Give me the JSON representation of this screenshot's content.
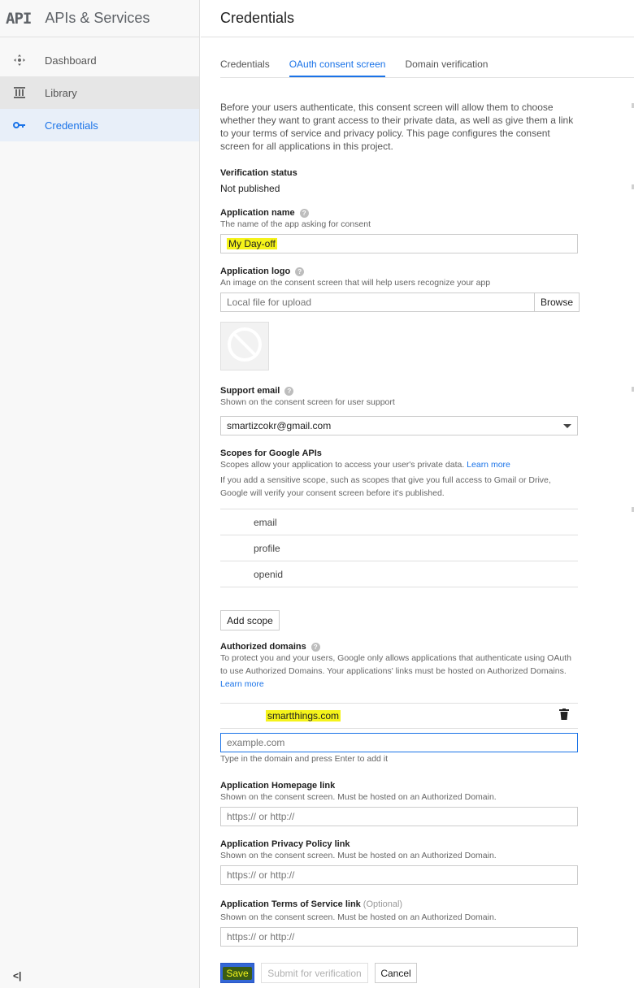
{
  "sidebar": {
    "logo": "API",
    "title": "APIs & Services",
    "items": [
      {
        "label": "Dashboard"
      },
      {
        "label": "Library"
      },
      {
        "label": "Credentials"
      }
    ],
    "collapse_icon": "<|"
  },
  "header": {
    "title": "Credentials"
  },
  "tabs": [
    "Credentials",
    "OAuth consent screen",
    "Domain verification"
  ],
  "intro": "Before your users authenticate, this consent screen will allow them to choose whether they want to grant access to their private data, as well as give them a link to your terms of service and privacy policy. This page configures the consent screen for all applications in this project.",
  "verification": {
    "label": "Verification status",
    "value": "Not published"
  },
  "app_name": {
    "label": "Application name",
    "help": "?",
    "desc": "The name of the app asking for consent",
    "value": "My Day-off"
  },
  "app_logo": {
    "label": "Application logo",
    "help": "?",
    "desc": "An image on the consent screen that will help users recognize your app",
    "placeholder": "Local file for upload",
    "browse": "Browse"
  },
  "support_email": {
    "label": "Support email",
    "help": "?",
    "desc": "Shown on the consent screen for user support",
    "value": "smartizcokr@gmail.com"
  },
  "scopes": {
    "label": "Scopes for Google APIs",
    "desc": "Scopes allow your application to access your user's private data.",
    "learn_more": "Learn more",
    "note": "If you add a sensitive scope, such as scopes that give you full access to Gmail or Drive, Google will verify your consent screen before it's published.",
    "items": [
      "email",
      "profile",
      "openid"
    ],
    "add_button": "Add scope"
  },
  "domains": {
    "label": "Authorized domains",
    "help": "?",
    "desc": "To protect you and your users, Google only allows applications that authenticate using OAuth to use Authorized Domains. Your applications' links must be hosted on Authorized Domains.",
    "learn_more": "Learn more",
    "items": [
      "smartthings.com"
    ],
    "placeholder": "example.com",
    "hint": "Type in the domain and press Enter to add it"
  },
  "homepage": {
    "label": "Application Homepage link",
    "desc": "Shown on the consent screen. Must be hosted on an Authorized Domain.",
    "placeholder": "https:// or http://"
  },
  "privacy": {
    "label": "Application Privacy Policy link",
    "desc": "Shown on the consent screen. Must be hosted on an Authorized Domain.",
    "placeholder": "https:// or http://"
  },
  "tos": {
    "label": "Application Terms of Service link",
    "optional": "(Optional)",
    "desc": "Shown on the consent screen. Must be hosted on an Authorized Domain.",
    "placeholder": "https:// or http://"
  },
  "actions": {
    "save": "Save",
    "submit": "Submit for verification",
    "cancel": "Cancel"
  },
  "colors": {
    "accent": "#1a73e8",
    "save_button": "#3367d6",
    "highlight": "#f5f31a"
  },
  "icons": [
    "dashboard-icon",
    "library-icon",
    "key-icon",
    "no-image-icon",
    "dropdown-arrow-icon",
    "trash-icon",
    "help-icon",
    "collapse-icon"
  ]
}
